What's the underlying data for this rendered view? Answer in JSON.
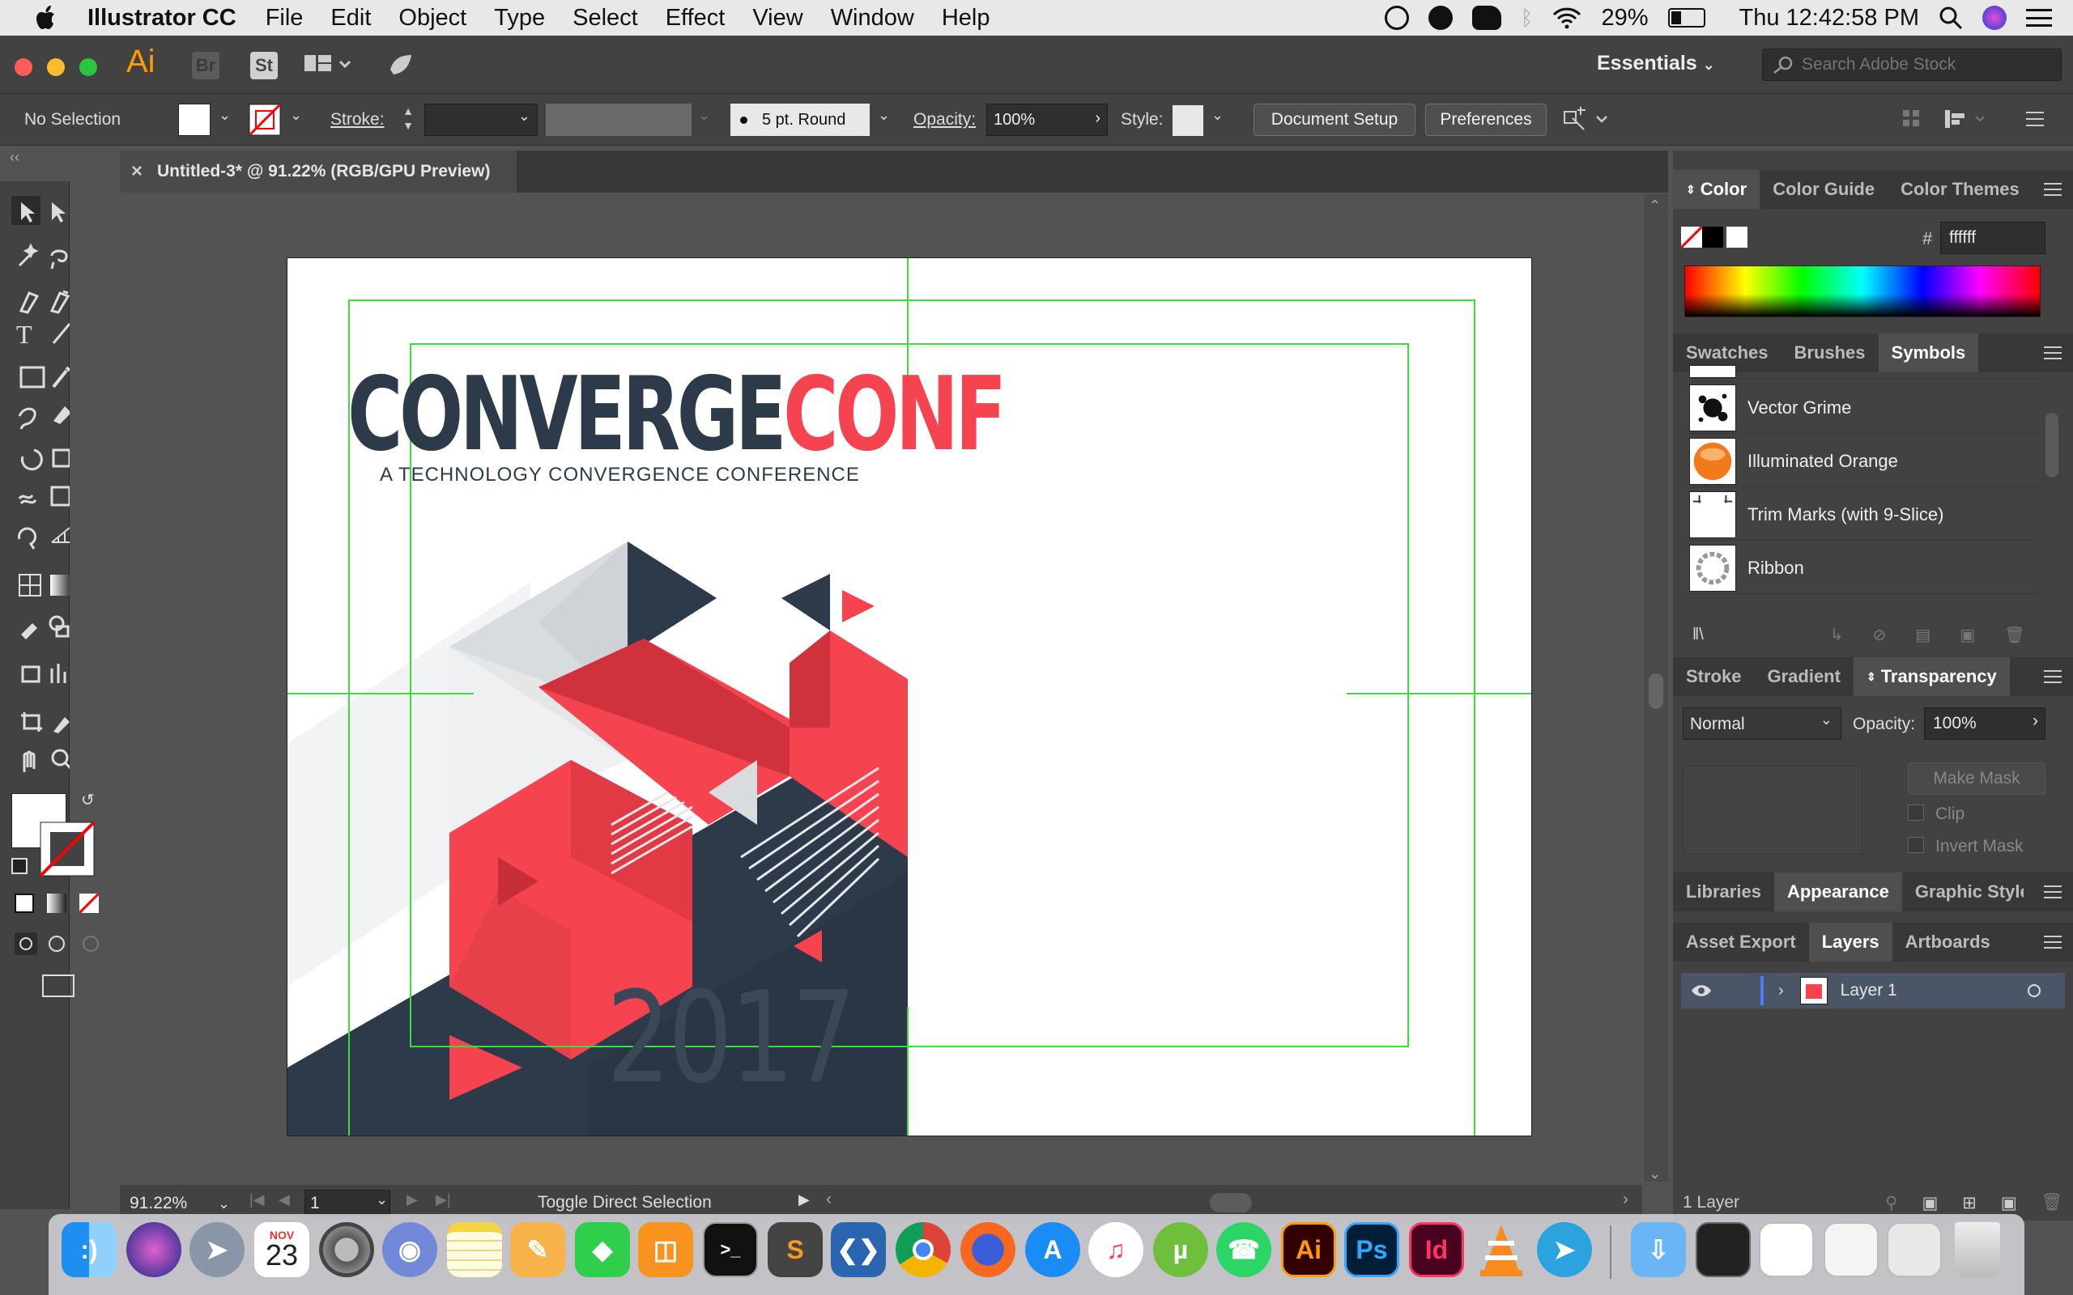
{
  "menubar": {
    "app_name": "Illustrator CC",
    "items": [
      "File",
      "Edit",
      "Object",
      "Type",
      "Select",
      "Effect",
      "View",
      "Window",
      "Help"
    ],
    "battery": "29%",
    "clock": "Thu 12:42:58 PM"
  },
  "appbar": {
    "ai_logo": "Ai",
    "br_label": "Br",
    "st_label": "St",
    "workspace": "Essentials",
    "search_placeholder": "Search Adobe Stock"
  },
  "control": {
    "selection": "No Selection",
    "stroke_label": "Stroke:",
    "brush": "5 pt. Round",
    "opacity_label": "Opacity:",
    "opacity_value": "100%",
    "style_label": "Style:",
    "document_setup": "Document Setup",
    "preferences": "Preferences"
  },
  "document": {
    "tab_title": "Untitled-3* @ 91.22% (RGB/GPU Preview)"
  },
  "artwork": {
    "title_dark": "CONVERGE",
    "title_red": "CONF",
    "subtitle": "A TECHNOLOGY CONVERGENCE CONFERENCE",
    "year": "2017",
    "colors": {
      "navy": "#2d3a4a",
      "red": "#f5434f",
      "darkred": "#d0323d",
      "gray": "#d9dcdf",
      "guide": "#3ddc3d"
    }
  },
  "status": {
    "zoom": "91.22%",
    "page": "1",
    "message": "Toggle Direct Selection"
  },
  "color_panel": {
    "tabs": [
      "Color",
      "Color Guide",
      "Color Themes"
    ],
    "hex_label": "#",
    "hex_value": "ffffff"
  },
  "symbols_panel": {
    "tabs": [
      "Swatches",
      "Brushes",
      "Symbols"
    ],
    "items": [
      "Vector Grime",
      "Illuminated Orange",
      "Trim Marks (with 9-Slice)",
      "Ribbon"
    ]
  },
  "transparency_panel": {
    "tabs": [
      "Stroke",
      "Gradient",
      "Transparency"
    ],
    "blend_mode": "Normal",
    "opacity_label": "Opacity:",
    "opacity_value": "100%",
    "make_mask": "Make Mask",
    "clip": "Clip",
    "invert_mask": "Invert Mask"
  },
  "appearance_tabs": [
    "Libraries",
    "Appearance",
    "Graphic Style"
  ],
  "layers_panel": {
    "tabs": [
      "Asset Export",
      "Layers",
      "Artboards"
    ],
    "layer_name": "Layer 1",
    "footer": "1 Layer"
  },
  "dock": {
    "calendar_month": "NOV",
    "calendar_day": "23",
    "ai": "Ai",
    "ps": "Ps",
    "id": "Id"
  }
}
